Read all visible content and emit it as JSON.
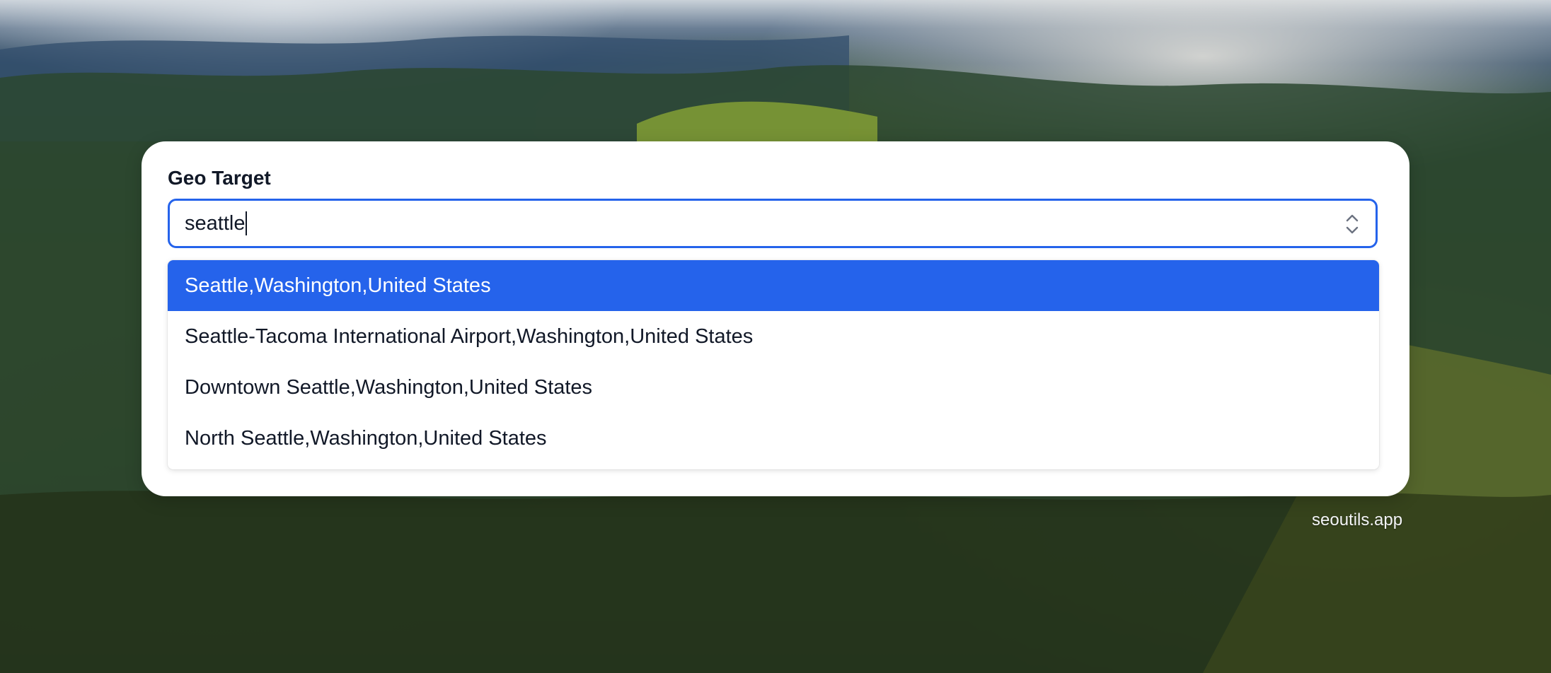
{
  "geo_target": {
    "label": "Geo Target",
    "input_value": "seattle",
    "options": [
      {
        "label": "Seattle,Washington,United States",
        "selected": true
      },
      {
        "label": "Seattle-Tacoma International Airport,Washington,United States",
        "selected": false
      },
      {
        "label": "Downtown Seattle,Washington,United States",
        "selected": false
      },
      {
        "label": "North Seattle,Washington,United States",
        "selected": false
      }
    ]
  },
  "footer": {
    "brand": "seoutils.app"
  },
  "colors": {
    "accent": "#2563eb",
    "card": "#ffffff",
    "text": "#111827"
  },
  "icons": {
    "combo_toggle": "chevron-up-down-icon"
  }
}
